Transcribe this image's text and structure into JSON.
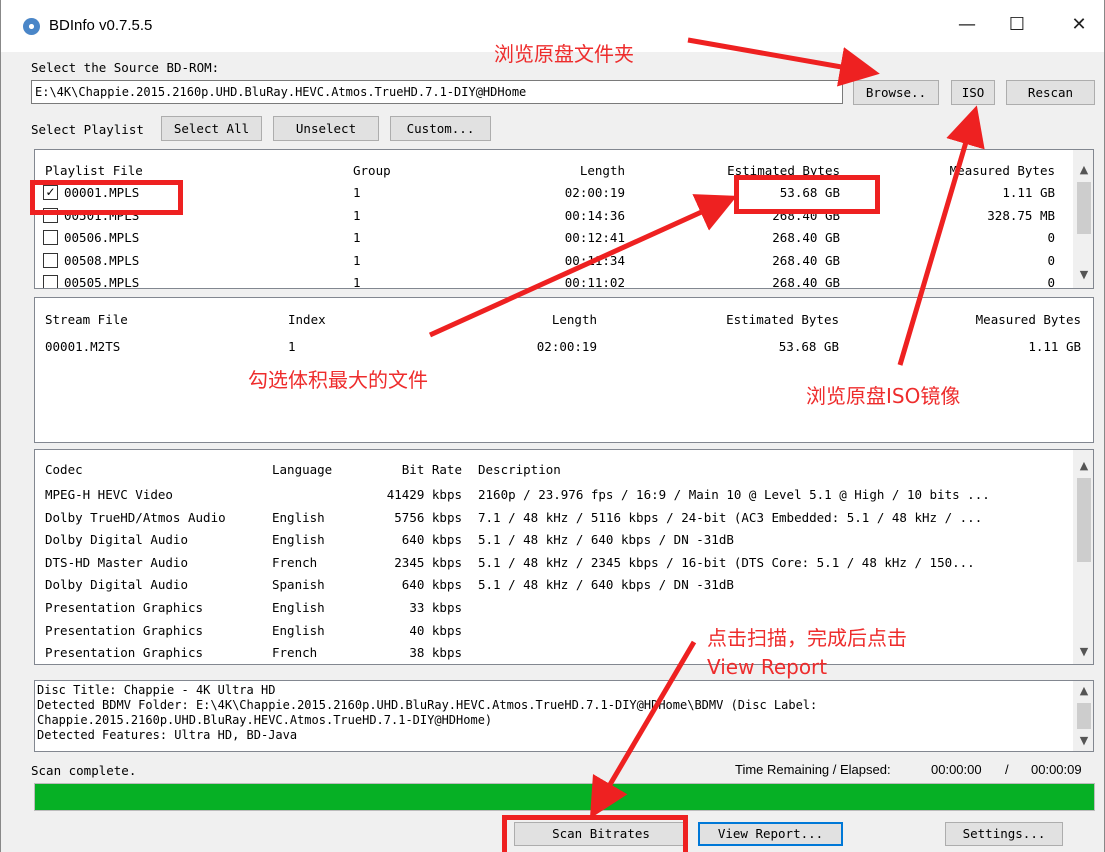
{
  "window": {
    "title": "BDInfo v0.7.5.5"
  },
  "source": {
    "label": "Select the Source BD-ROM:",
    "path": "E:\\4K\\Chappie.2015.2160p.UHD.BluRay.HEVC.Atmos.TrueHD.7.1-DIY@HDHome",
    "browse_label": "Browse..",
    "iso_label": "ISO",
    "rescan_label": "Rescan"
  },
  "playlist_toolbar": {
    "label": "Select Playlist",
    "select_all": "Select All",
    "unselect": "Unselect",
    "custom": "Custom..."
  },
  "playlist": {
    "headers": [
      "Playlist File",
      "Group",
      "Length",
      "Estimated Bytes",
      "Measured Bytes"
    ],
    "rows": [
      {
        "checked": true,
        "file": "00001.MPLS",
        "group": "1",
        "length": "02:00:19",
        "estimated": "53.68 GB",
        "measured": "1.11 GB"
      },
      {
        "checked": false,
        "file": "00501.MPLS",
        "group": "1",
        "length": "00:14:36",
        "estimated": "268.40 GB",
        "measured": "328.75 MB"
      },
      {
        "checked": false,
        "file": "00506.MPLS",
        "group": "1",
        "length": "00:12:41",
        "estimated": "268.40 GB",
        "measured": "0"
      },
      {
        "checked": false,
        "file": "00508.MPLS",
        "group": "1",
        "length": "00:11:34",
        "estimated": "268.40 GB",
        "measured": "0"
      },
      {
        "checked": false,
        "file": "00505.MPLS",
        "group": "1",
        "length": "00:11:02",
        "estimated": "268.40 GB",
        "measured": "0"
      }
    ]
  },
  "streams": {
    "headers": [
      "Stream File",
      "Index",
      "Length",
      "Estimated Bytes",
      "Measured Bytes"
    ],
    "rows": [
      {
        "file": "00001.M2TS",
        "index": "1",
        "length": "02:00:19",
        "estimated": "53.68 GB",
        "measured": "1.11 GB"
      }
    ]
  },
  "codecs": {
    "headers": [
      "Codec",
      "Language",
      "Bit Rate",
      "Description"
    ],
    "rows": [
      {
        "codec": "MPEG-H HEVC Video",
        "language": "",
        "bitrate": "41429 kbps",
        "description": "2160p / 23.976 fps / 16:9 / Main 10 @ Level 5.1 @ High / 10 bits ..."
      },
      {
        "codec": "Dolby TrueHD/Atmos Audio",
        "language": "English",
        "bitrate": "5756 kbps",
        "description": "7.1 / 48 kHz /  5116 kbps / 24-bit (AC3 Embedded: 5.1 / 48 kHz / ..."
      },
      {
        "codec": "Dolby Digital Audio",
        "language": "English",
        "bitrate": "640 kbps",
        "description": "5.1 / 48 kHz /  640 kbps / DN -31dB"
      },
      {
        "codec": "DTS-HD Master Audio",
        "language": "French",
        "bitrate": "2345 kbps",
        "description": "5.1 / 48 kHz /  2345 kbps / 16-bit (DTS Core: 5.1 / 48 kHz /  150..."
      },
      {
        "codec": "Dolby Digital Audio",
        "language": "Spanish",
        "bitrate": "640 kbps",
        "description": "5.1 / 48 kHz /  640 kbps / DN -31dB"
      },
      {
        "codec": "Presentation Graphics",
        "language": "English",
        "bitrate": "33 kbps",
        "description": ""
      },
      {
        "codec": "Presentation Graphics",
        "language": "English",
        "bitrate": "40 kbps",
        "description": ""
      },
      {
        "codec": "Presentation Graphics",
        "language": "French",
        "bitrate": "38 kbps",
        "description": ""
      }
    ]
  },
  "log": {
    "lines": [
      "Disc Title: Chappie - 4K Ultra HD",
      "Detected BDMV Folder: E:\\4K\\Chappie.2015.2160p.UHD.BluRay.HEVC.Atmos.TrueHD.7.1-DIY@HDHome\\BDMV (Disc Label:",
      "Chappie.2015.2160p.UHD.BluRay.HEVC.Atmos.TrueHD.7.1-DIY@HDHome)",
      "Detected Features: Ultra HD, BD-Java"
    ]
  },
  "status": {
    "text": "Scan complete.",
    "time_label": "Time Remaining / Elapsed:",
    "remaining": "00:00:00",
    "separator": "/",
    "elapsed": "00:00:09",
    "progress": 1.0,
    "progress_color": "#06b025"
  },
  "buttons": {
    "scan": "Scan Bitrates",
    "report": "View Report...",
    "settings": "Settings..."
  },
  "annotations": {
    "browse_folder": "浏览原盘文件夹",
    "select_largest": "勾选体积最大的文件",
    "browse_iso": "浏览原盘ISO镜像",
    "click_scan": "点击扫描，完成后点击",
    "view_report": "View Report",
    "color": "#ee2121"
  },
  "icons": [
    "bdinfo-disc-icon",
    "minimize-icon",
    "maximize-icon",
    "close-icon",
    "checkbox-checked-icon",
    "scroll-up-icon",
    "scroll-down-icon"
  ]
}
